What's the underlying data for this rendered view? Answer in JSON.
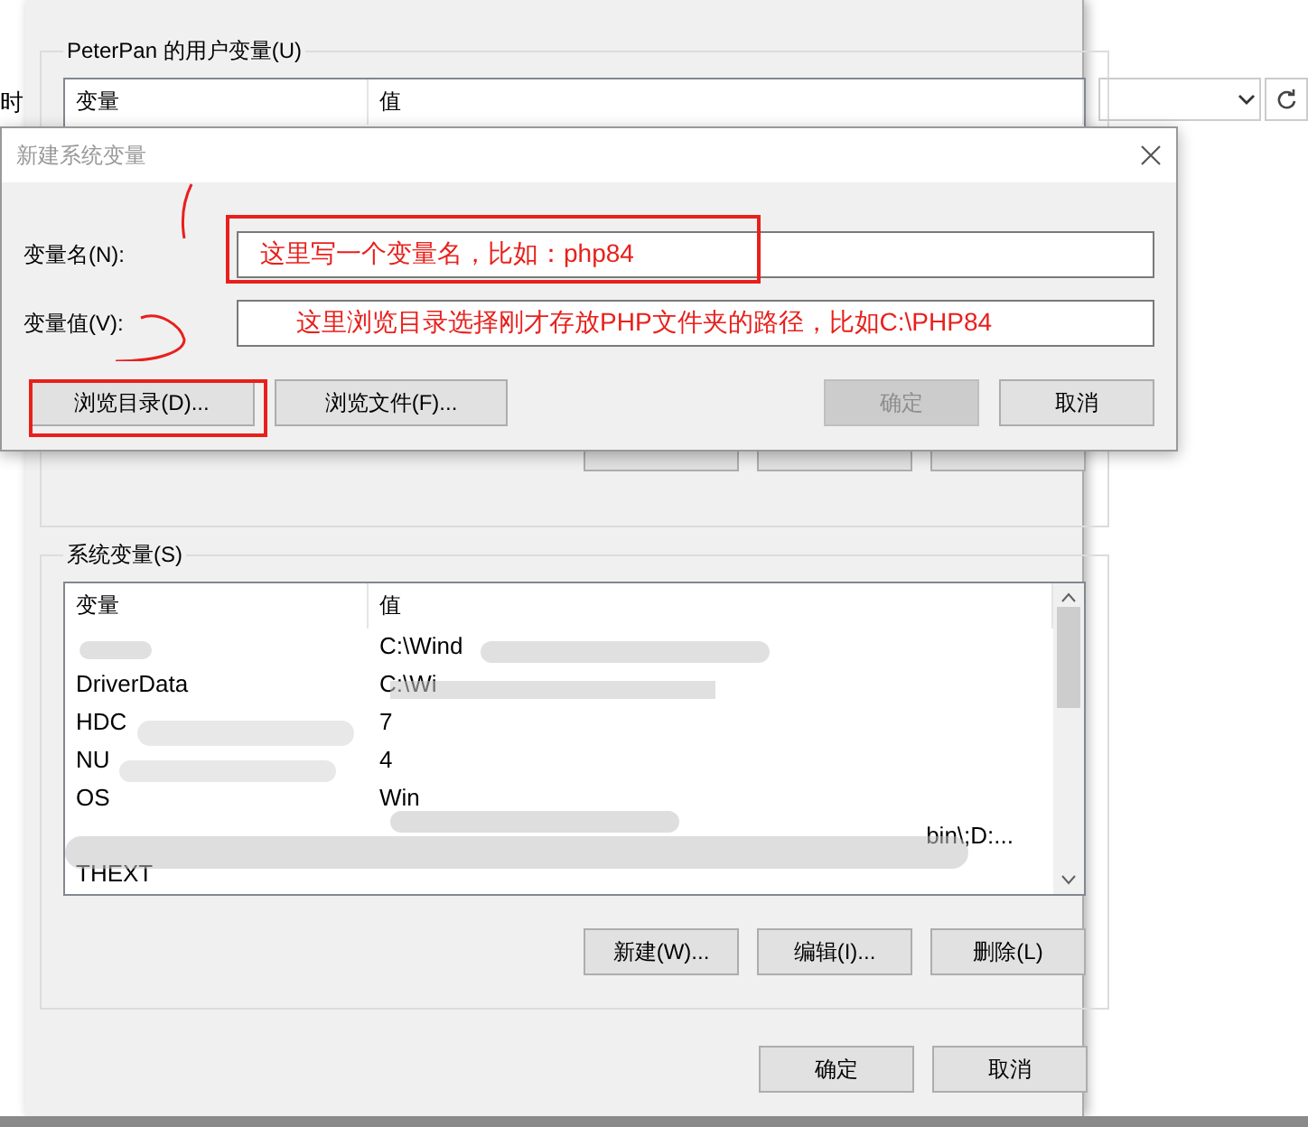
{
  "background_app": {
    "left_texts": [
      "时"
    ]
  },
  "env_dialog": {
    "user_group": {
      "title": "PeterPan 的用户变量(U)",
      "columns": [
        "变量",
        "值"
      ],
      "buttons": [
        {
          "disabled": false
        },
        {
          "disabled": false
        },
        {
          "disabled": false
        }
      ]
    },
    "system_group": {
      "title": "系统变量(S)",
      "columns": [
        "变量",
        "值"
      ],
      "rows": [
        {
          "value": "C:\\Wind"
        },
        {
          "name": "DriverData",
          "value": "C:\\Wi"
        },
        {
          "name": "HDC",
          "value": "7"
        },
        {
          "name": "NU",
          "value": "4"
        },
        {
          "name": "OS",
          "value": "Win"
        },
        {
          "value": "bin\\;D:..."
        },
        {
          "name": "THEXT"
        }
      ],
      "buttons": [
        "新建(W)...",
        "编辑(I)...",
        "删除(L)"
      ]
    },
    "buttons": [
      "确定",
      "取消"
    ]
  },
  "new_var_dialog": {
    "title": "新建系统变量",
    "fields": [
      {
        "label": "变量名(N):",
        "annotation": "这里写一个变量名，比如：php84"
      },
      {
        "label": "变量值(V):",
        "annotation": "这里浏览目录选择刚才存放PHP文件夹的路径，比如C:\\PHP84"
      }
    ],
    "buttons": [
      {
        "label": "浏览目录(D)...",
        "disabled": false
      },
      {
        "label": "浏览文件(F)...",
        "disabled": false
      },
      {
        "label": "确定",
        "disabled": true
      },
      {
        "label": "取消",
        "disabled": false
      }
    ]
  }
}
